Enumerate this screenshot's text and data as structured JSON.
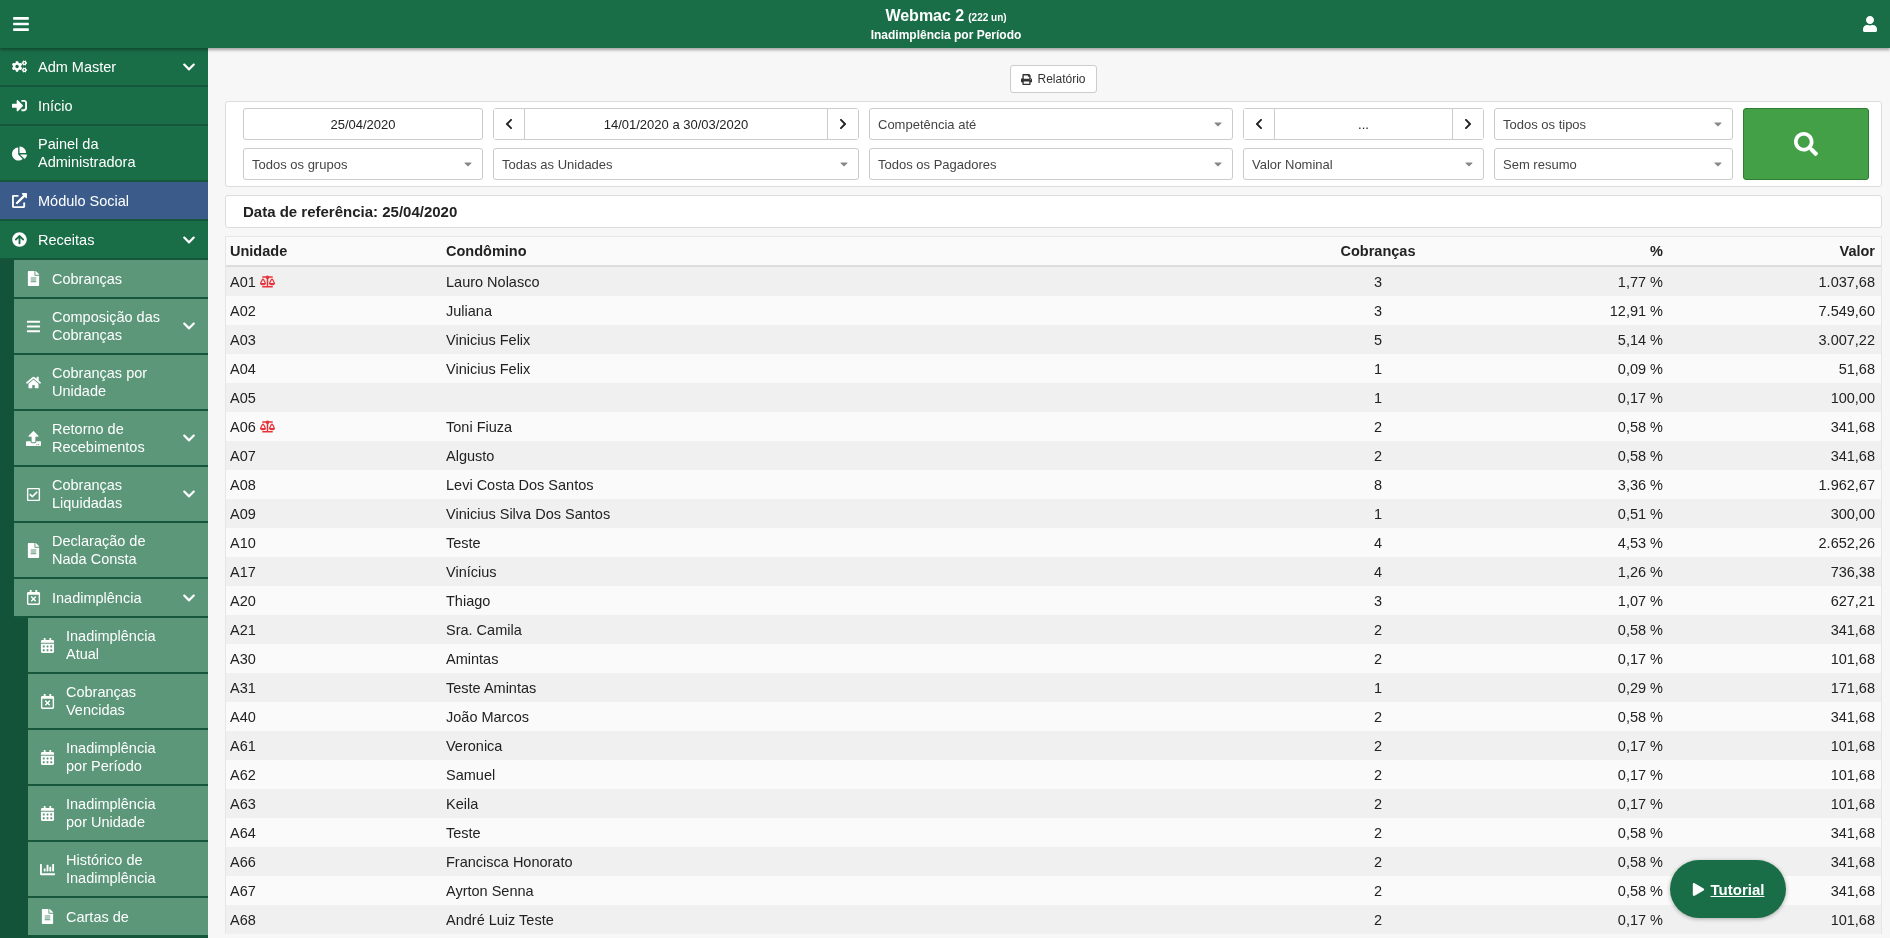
{
  "header": {
    "title": "Webmac 2",
    "title_note": "(222 un)",
    "subtitle": "Inadimplência por Período"
  },
  "sidebar": {
    "items": [
      {
        "label": "Adm Master",
        "kind": "group"
      },
      {
        "label": "Início",
        "kind": "link"
      },
      {
        "label": "Painel da Administradora",
        "kind": "link"
      },
      {
        "label": "Módulo Social",
        "kind": "external"
      },
      {
        "label": "Receitas",
        "kind": "group",
        "children": [
          {
            "label": "Cobranças",
            "kind": "link"
          },
          {
            "label": "Composição das Cobranças",
            "kind": "group"
          },
          {
            "label": "Cobranças por Unidade",
            "kind": "link"
          },
          {
            "label": "Retorno de Recebimentos",
            "kind": "group"
          },
          {
            "label": "Cobranças Liquidadas",
            "kind": "group"
          },
          {
            "label": "Declaração de Nada Consta",
            "kind": "link"
          },
          {
            "label": "Inadimplência",
            "kind": "group",
            "children": [
              {
                "label": "Inadimplência Atual",
                "kind": "link"
              },
              {
                "label": "Cobranças Vencidas",
                "kind": "link"
              },
              {
                "label": "Inadimplência por Período",
                "kind": "link"
              },
              {
                "label": "Inadimplência por Unidade",
                "kind": "link"
              },
              {
                "label": "Histórico de Inadimplência",
                "kind": "link"
              },
              {
                "label": "Cartas de",
                "kind": "link"
              }
            ]
          }
        ]
      }
    ]
  },
  "report_button": "Relatório",
  "filters": [
    [
      {
        "kind": "date",
        "value": "25/04/2020"
      },
      {
        "kind": "range",
        "value": "14/01/2020 a 30/03/2020"
      },
      {
        "kind": "select",
        "value": "Competência até"
      },
      {
        "kind": "range",
        "value": "..."
      },
      {
        "kind": "select",
        "value": "Todos os tipos"
      }
    ],
    [
      {
        "kind": "select",
        "value": "Todos os grupos"
      },
      {
        "kind": "select",
        "value": "Todas as Unidades"
      },
      {
        "kind": "select",
        "value": "Todos os Pagadores"
      },
      {
        "kind": "select",
        "value": "Valor Nominal"
      },
      {
        "kind": "select",
        "value": "Sem resumo"
      }
    ]
  ],
  "reference_date": "Data de referência: 25/04/2020",
  "table": {
    "columns": [
      "Unidade",
      "Condômino",
      "Cobranças",
      "%",
      "Valor"
    ],
    "rows": [
      {
        "unit": "A01",
        "judicial": true,
        "owner": "Lauro Nolasco",
        "charges": "3",
        "percent": "1,77 %",
        "value": "1.037,68"
      },
      {
        "unit": "A02",
        "judicial": false,
        "owner": "Juliana",
        "charges": "3",
        "percent": "12,91 %",
        "value": "7.549,60"
      },
      {
        "unit": "A03",
        "judicial": false,
        "owner": "Vinicius Felix",
        "charges": "5",
        "percent": "5,14 %",
        "value": "3.007,22"
      },
      {
        "unit": "A04",
        "judicial": false,
        "owner": "Vinicius Felix",
        "charges": "1",
        "percent": "0,09 %",
        "value": "51,68"
      },
      {
        "unit": "A05",
        "judicial": false,
        "charges": "1",
        "percent": "0,17 %",
        "value": "100,00"
      },
      {
        "unit": "A06",
        "judicial": true,
        "owner": "Toni Fiuza",
        "charges": "2",
        "percent": "0,58 %",
        "value": "341,68"
      },
      {
        "unit": "A07",
        "judicial": false,
        "owner": "Algusto",
        "charges": "2",
        "percent": "0,58 %",
        "value": "341,68"
      },
      {
        "unit": "A08",
        "judicial": false,
        "owner": "Levi Costa Dos Santos",
        "charges": "8",
        "percent": "3,36 %",
        "value": "1.962,67"
      },
      {
        "unit": "A09",
        "judicial": false,
        "owner": "Vinicius Silva Dos Santos",
        "charges": "1",
        "percent": "0,51 %",
        "value": "300,00"
      },
      {
        "unit": "A10",
        "judicial": false,
        "owner": "Teste",
        "charges": "4",
        "percent": "4,53 %",
        "value": "2.652,26"
      },
      {
        "unit": "A17",
        "judicial": false,
        "owner": "Vinícius",
        "charges": "4",
        "percent": "1,26 %",
        "value": "736,38"
      },
      {
        "unit": "A20",
        "judicial": false,
        "owner": "Thiago",
        "charges": "3",
        "percent": "1,07 %",
        "value": "627,21"
      },
      {
        "unit": "A21",
        "judicial": false,
        "owner": "Sra. Camila",
        "charges": "2",
        "percent": "0,58 %",
        "value": "341,68"
      },
      {
        "unit": "A30",
        "judicial": false,
        "owner": "Amintas",
        "charges": "2",
        "percent": "0,17 %",
        "value": "101,68"
      },
      {
        "unit": "A31",
        "judicial": false,
        "owner": "Teste Amintas",
        "charges": "1",
        "percent": "0,29 %",
        "value": "171,68"
      },
      {
        "unit": "A40",
        "judicial": false,
        "owner": "João Marcos",
        "charges": "2",
        "percent": "0,58 %",
        "value": "341,68"
      },
      {
        "unit": "A61",
        "judicial": false,
        "owner": "Veronica",
        "charges": "2",
        "percent": "0,17 %",
        "value": "101,68"
      },
      {
        "unit": "A62",
        "judicial": false,
        "owner": "Samuel",
        "charges": "2",
        "percent": "0,17 %",
        "value": "101,68"
      },
      {
        "unit": "A63",
        "judicial": false,
        "owner": "Keila",
        "charges": "2",
        "percent": "0,17 %",
        "value": "101,68"
      },
      {
        "unit": "A64",
        "judicial": false,
        "owner": "Teste",
        "charges": "2",
        "percent": "0,58 %",
        "value": "341,68"
      },
      {
        "unit": "A66",
        "judicial": false,
        "owner": "Francisca Honorato",
        "charges": "2",
        "percent": "0,58 %",
        "value": "341,68"
      },
      {
        "unit": "A67",
        "judicial": false,
        "owner": "Ayrton Senna",
        "charges": "2",
        "percent": "0,58 %",
        "value": "341,68"
      },
      {
        "unit": "A68",
        "judicial": false,
        "owner": "André Luiz Teste",
        "charges": "2",
        "percent": "0,17 %",
        "value": "101,68"
      }
    ]
  },
  "tutorial_button": "Tutorial"
}
